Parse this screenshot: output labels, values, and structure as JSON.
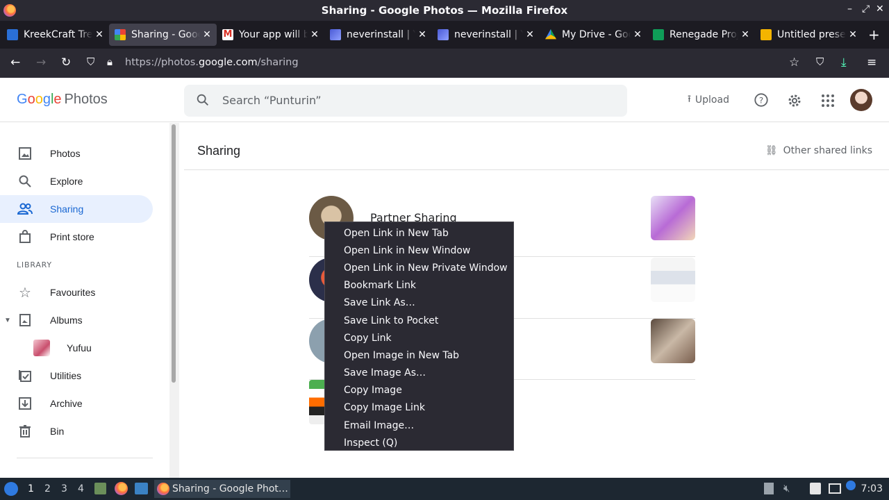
{
  "window": {
    "title": "Sharing - Google Photos — Mozilla Firefox"
  },
  "tabs": [
    {
      "label": "KreekCraft Tre",
      "active": false,
      "color": "#2a6fd6"
    },
    {
      "label": "Sharing - Goog",
      "active": true,
      "color": "#ea4335"
    },
    {
      "label": "Your app will b",
      "active": false,
      "color": "#d93025"
    },
    {
      "label": "neverinstall | Y",
      "active": false,
      "color": "#4b5bd6"
    },
    {
      "label": "neverinstall | Y",
      "active": false,
      "color": "#4b5bd6"
    },
    {
      "label": "My Drive - Goo",
      "active": false,
      "color": "#0f9d58"
    },
    {
      "label": "Renegade Proj",
      "active": false,
      "color": "#0f9d58"
    },
    {
      "label": "Untitled preser",
      "active": false,
      "color": "#f4b400"
    }
  ],
  "address": {
    "prefix": "https://photos.",
    "domain": "google.com",
    "path": "/sharing"
  },
  "header": {
    "logo_google": [
      "G",
      "o",
      "o",
      "g",
      "l",
      "e"
    ],
    "logo_photos": "Photos",
    "search_placeholder": "Search “Punturin”",
    "upload_label": "Upload"
  },
  "sidebar": {
    "items": [
      {
        "label": "Photos",
        "icon": "photo-icon",
        "active": false
      },
      {
        "label": "Explore",
        "icon": "search-icon",
        "active": false
      },
      {
        "label": "Sharing",
        "icon": "people-icon",
        "active": true
      },
      {
        "label": "Print store",
        "icon": "bag-icon",
        "active": false
      }
    ],
    "library_label": "LIBRARY",
    "library_items": [
      {
        "label": "Favourites",
        "icon": "star-icon"
      },
      {
        "label": "Albums",
        "icon": "album-icon"
      },
      {
        "label": "Yufuu",
        "icon": "album-thumb"
      },
      {
        "label": "Utilities",
        "icon": "utilities-icon"
      },
      {
        "label": "Archive",
        "icon": "archive-icon"
      },
      {
        "label": "Bin",
        "icon": "bin-icon"
      }
    ]
  },
  "main": {
    "title": "Sharing",
    "other_shared_links": "Other shared links",
    "rows": [
      {
        "name": "Partner Sharing"
      }
    ]
  },
  "context_menu": {
    "items": [
      "Open Link in New Tab",
      "Open Link in New Window",
      "Open Link in New Private Window",
      "Bookmark Link",
      "Save Link As…",
      "Save Link to Pocket",
      "Copy Link",
      "Open Image in New Tab",
      "Save Image As…",
      "Copy Image",
      "Copy Image Link",
      "Email Image…",
      "Inspect (Q)"
    ]
  },
  "taskbar": {
    "workspaces": [
      "1",
      "2",
      "3",
      "4"
    ],
    "task_label": "Sharing - Google Phot…",
    "clock": "7:03"
  }
}
